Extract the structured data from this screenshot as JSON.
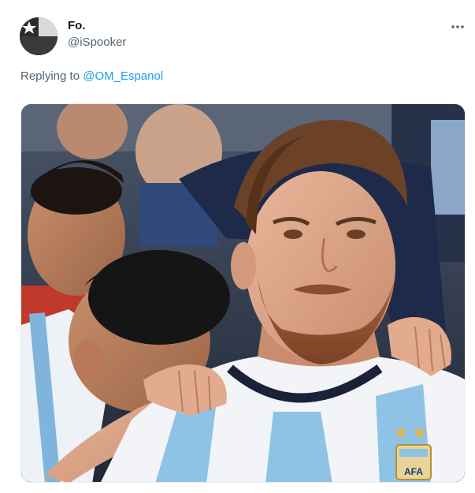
{
  "tweet": {
    "author": {
      "display_name": "Fo.",
      "handle": "@iSpooker",
      "avatar_icon": "chile-flag-avatar"
    },
    "more_icon": "more-dots-icon",
    "reply": {
      "prefix": "Replying to",
      "mention": "@OM_Espanol"
    },
    "media": {
      "type": "photo",
      "badge_text": "AFA"
    }
  },
  "colors": {
    "text_primary": "#0f1419",
    "text_secondary": "#536471",
    "link": "#1d9bf0",
    "jersey_sky_blue": "#8fc3e6",
    "jersey_white": "#f2f4f7"
  }
}
